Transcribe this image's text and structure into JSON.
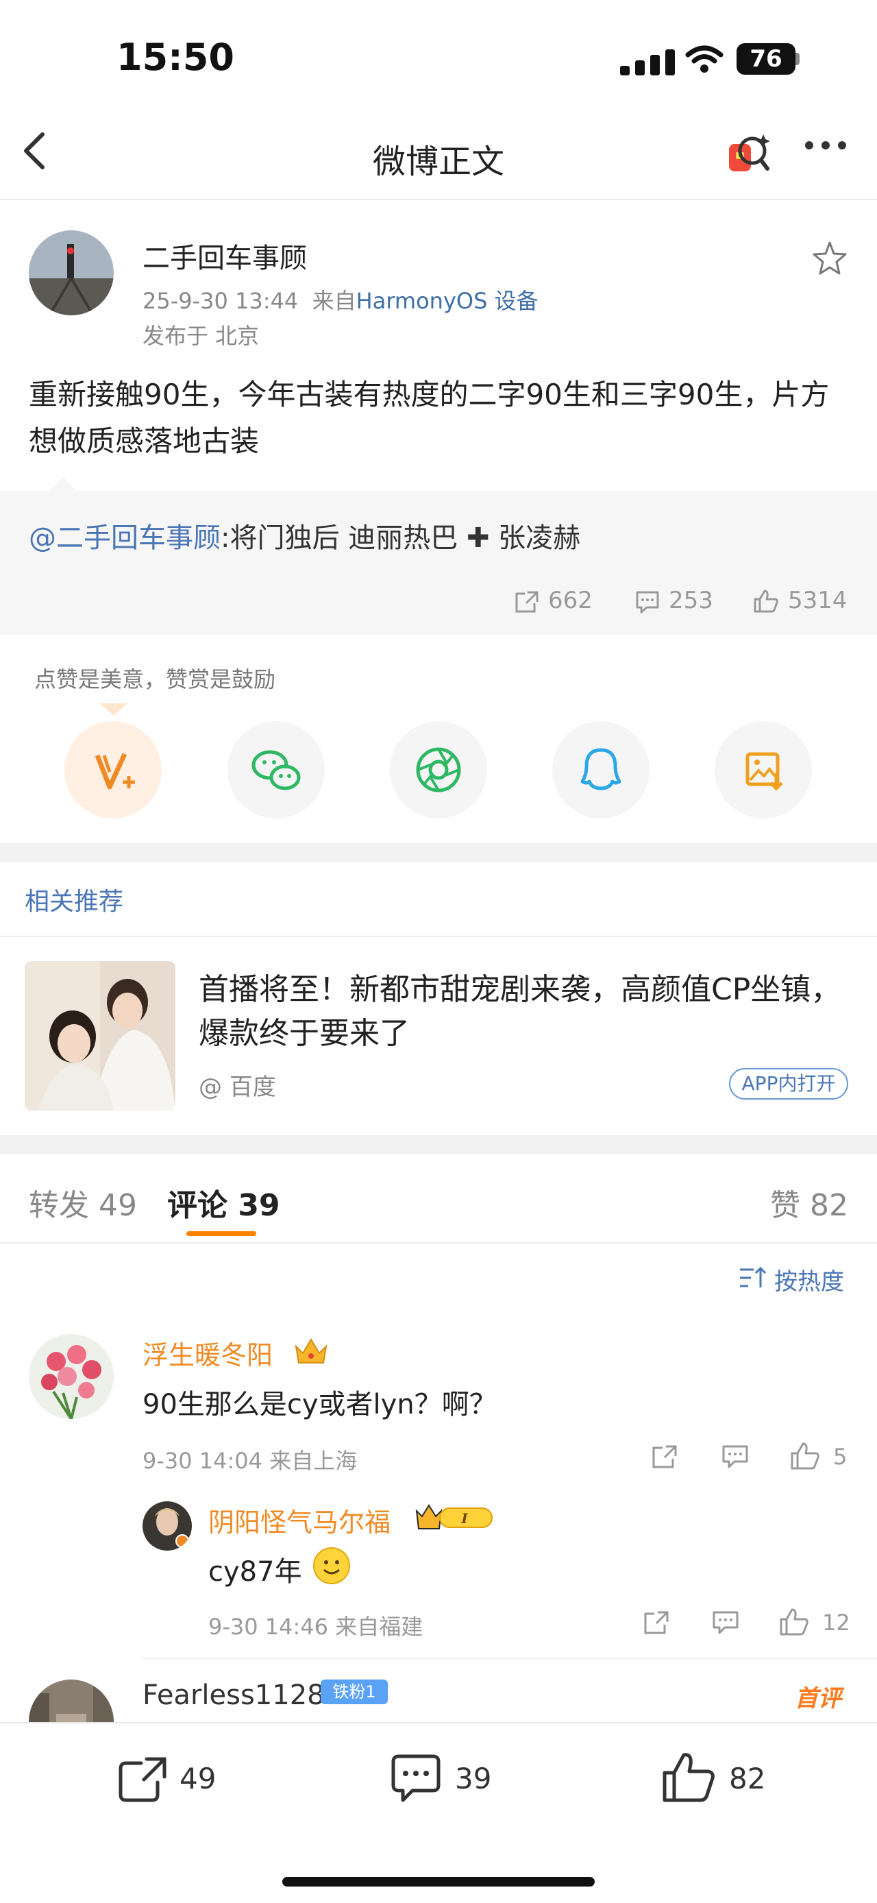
{
  "status_bar": {
    "time": "15:50",
    "battery": "76"
  },
  "nav": {
    "title": "微博正文"
  },
  "post": {
    "author": "二手回车事顾",
    "date": "25-9-30 13:44",
    "source_prefix": "来自",
    "source": "HarmonyOS 设备",
    "location": "发布于 北京",
    "text": "重新接触90生，今年古装有热度的二字90生和三字90生，片方想做质感落地古装",
    "quote": {
      "mention": "@二手回车事顾",
      "text": ":将门独后  迪丽热巴 ✚ 张凌赫"
    },
    "stats": {
      "reposts": "662",
      "comments": "253",
      "likes": "5314"
    }
  },
  "reward": {
    "label": "点赞是美意，赞赏是鼓励"
  },
  "related": {
    "title": "相关推荐",
    "ad": {
      "title": "首播将至！新都市甜宠剧来袭，高颜值CP坐镇，爆款终于要来了",
      "source": "@ 百度",
      "badge": "APP内打开"
    }
  },
  "tabs": {
    "reposts": "转发 49",
    "comments": "评论 39",
    "likes": "赞 82"
  },
  "sort": {
    "label": "按热度"
  },
  "comments": [
    {
      "name": "浮生暖冬阳",
      "text": "90生那么是cy或者lyn？啊？",
      "meta": "9-30 14:04  来自上海",
      "likes": "5",
      "reply": {
        "name": "阴阳怪气马尔福",
        "text": "cy87年",
        "meta": "9-30 14:46  来自福建",
        "likes": "12"
      }
    },
    {
      "name": "Fearless1128",
      "fan_badge": "铁粉1",
      "first_badge": "首评"
    }
  ],
  "bottom_bar": {
    "reposts": "49",
    "comments": "39",
    "likes": "82"
  },
  "colors": {
    "accent": "#ff8200",
    "link": "#4a76b5",
    "username": "#f08a24"
  }
}
